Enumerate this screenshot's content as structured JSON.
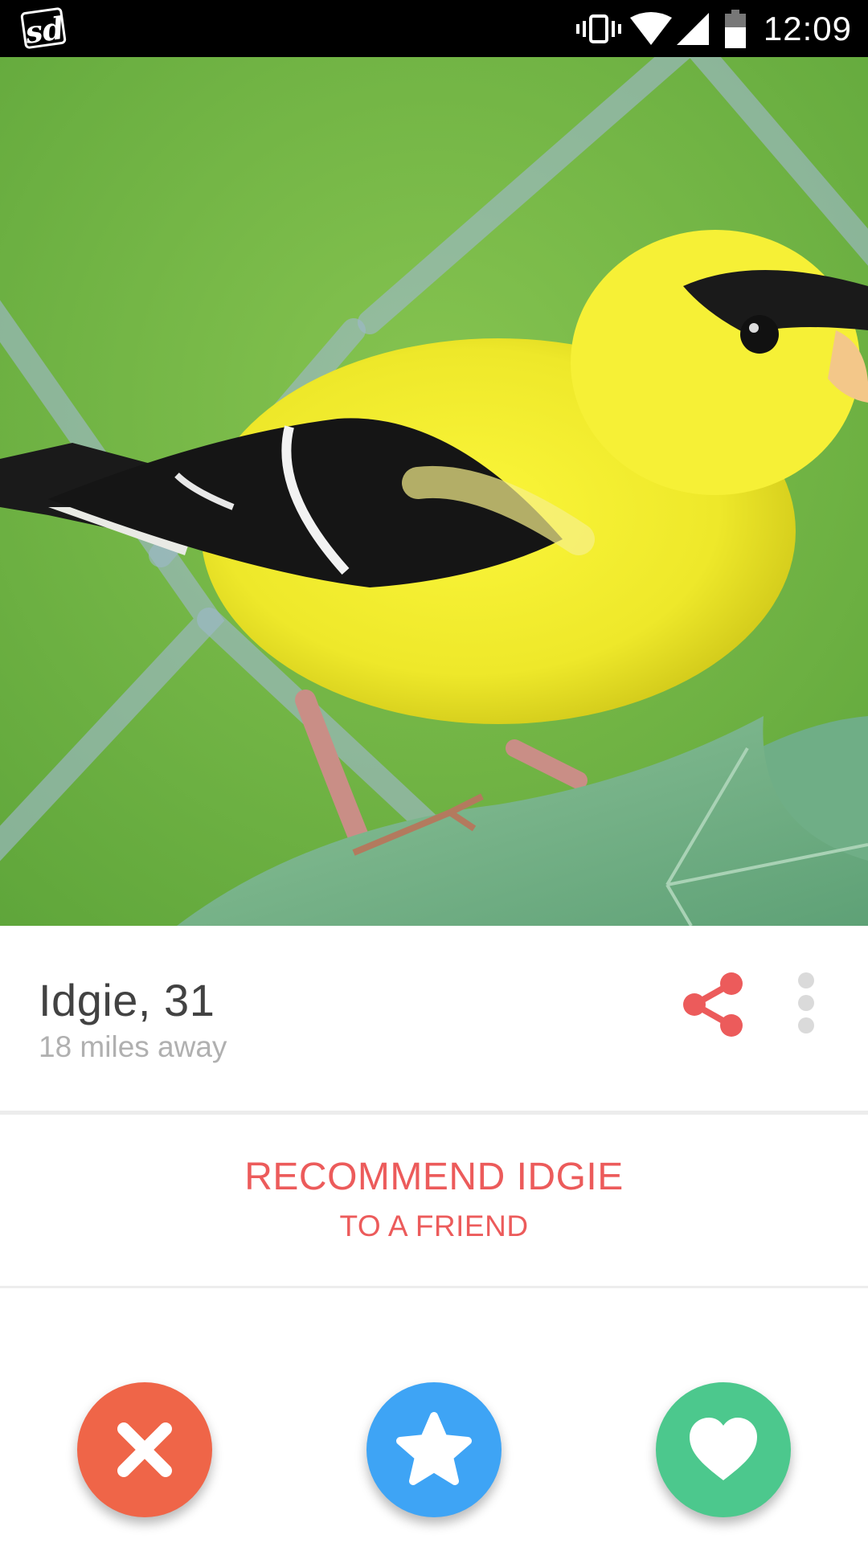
{
  "status_bar": {
    "app_icon_text": "sd",
    "time": "12:09",
    "icons": [
      "vibrate-icon",
      "wifi-icon",
      "signal-icon",
      "battery-icon"
    ]
  },
  "photo": {
    "subject": "bird-photo"
  },
  "profile": {
    "name_age": "Idgie, 31",
    "distance": "18 miles away"
  },
  "actions": {
    "share_icon": "share-icon",
    "more_icon": "more-vertical-icon"
  },
  "recommend": {
    "line1": "RECOMMEND IDGIE",
    "line2": "TO A FRIEND"
  },
  "buttons": {
    "nope_icon": "close-icon",
    "superlike_icon": "star-icon",
    "like_icon": "heart-icon"
  },
  "colors": {
    "accent": "#ec5b5b",
    "nope": "#ef6548",
    "superlike": "#3ea4f5",
    "like": "#4cc88d",
    "name_text": "#424242",
    "distance_text": "#b0b0b0"
  }
}
